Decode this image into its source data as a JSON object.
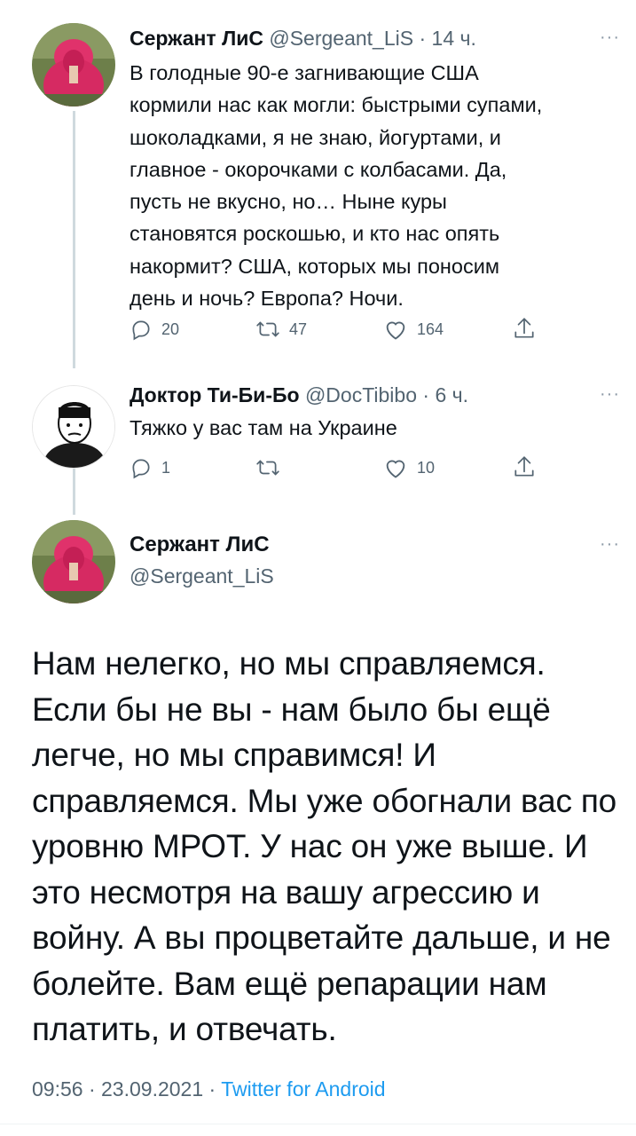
{
  "tweet1": {
    "name": "Сержант ЛиС",
    "handle": "@Sergeant_LiS",
    "time": "· 14 ч.",
    "text_lines": [
      "В голодные 90-е загнивающие США",
      "кормили нас как могли: быстрыми супами,",
      "шоколадками, я не знаю, йогуртами, и",
      "главное - окорочками с колбасами. Да,",
      "пусть не вкусно, но… Ныне куры",
      "становятся роскошью, и кто нас опять",
      "накормит? США, которых мы поносим",
      "день и ночь? Европа? Ночи."
    ],
    "replies": "20",
    "retweets": "47",
    "likes": "164"
  },
  "tweet2": {
    "name": "Доктор Ти-Би-Бо",
    "handle": "@DocTibibo",
    "time": "· 6 ч.",
    "text": "Тяжко у вас там на Украине",
    "replies": "1",
    "retweets": "",
    "likes": "10"
  },
  "main_tweet": {
    "name": "Сержант ЛиС",
    "handle": "@Sergeant_LiS",
    "text_lines": [
      "Нам нелегко, но мы справляемся.",
      "Если бы не вы - нам было бы ещё",
      "легче, но мы справимся! И",
      "справляемся. Мы уже обогнали вас по",
      "уровню МРОТ. У нас он уже выше. И",
      "это несмотря на вашу агрессию и",
      "войну. А вы процветайте дальше, и не",
      "болейте. Вам ещё репарации нам",
      "платить, и отвечать."
    ],
    "time": "09:56",
    "date": "23.09.2021",
    "separator": "·",
    "source": "Twitter for Android"
  },
  "more_glyph": "···"
}
